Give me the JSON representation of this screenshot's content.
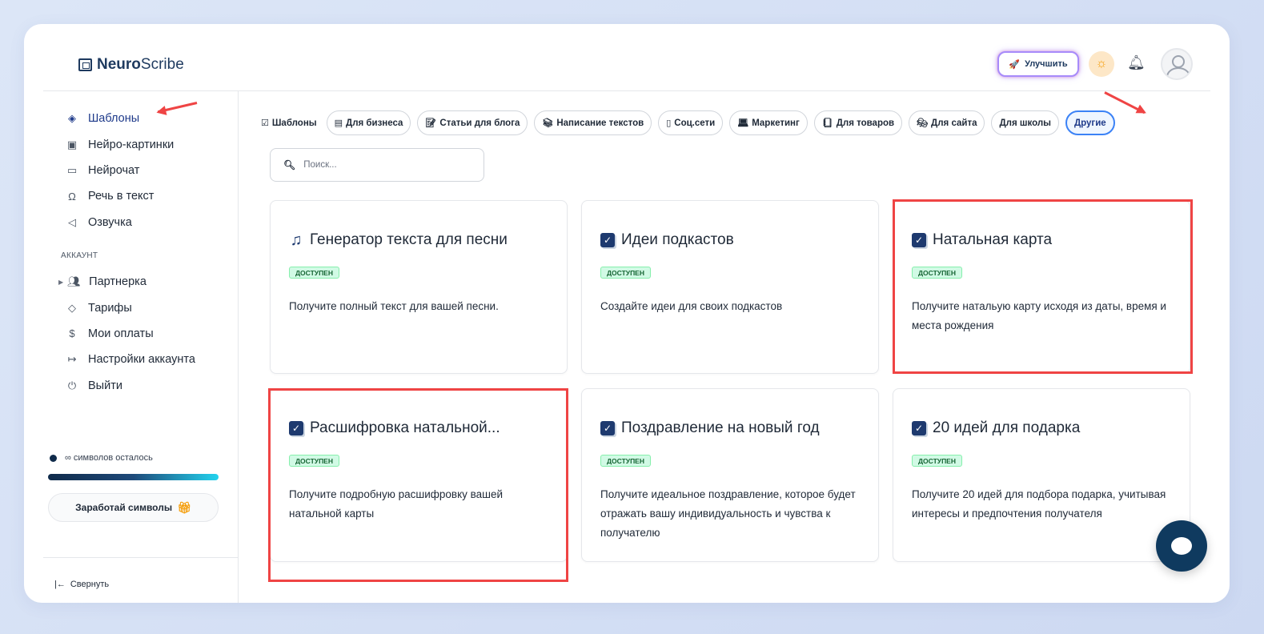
{
  "brand": {
    "bold": "Neuro",
    "light": "Scribe"
  },
  "header": {
    "upgrade_label": "Улучшить"
  },
  "sidebar": {
    "main_items": [
      {
        "label": "Шаблоны",
        "icon": "layers-icon"
      },
      {
        "label": "Нейро-картинки",
        "icon": "image-icon"
      },
      {
        "label": "Нейрочат",
        "icon": "chat-icon"
      },
      {
        "label": "Речь в текст",
        "icon": "headphones-icon"
      },
      {
        "label": "Озвучка",
        "icon": "speaker-icon"
      }
    ],
    "section_label": "АККАУНТ",
    "account_items": [
      {
        "label": "Партнерка",
        "icon": "users-icon"
      },
      {
        "label": "Тарифы",
        "icon": "tag-icon"
      },
      {
        "label": "Мои оплаты",
        "icon": "dollar-icon"
      },
      {
        "label": "Настройки аккаунта",
        "icon": "logout-arrow-icon"
      },
      {
        "label": "Выйти",
        "icon": "power-icon"
      }
    ],
    "symbols_left": "∞ символов осталось",
    "symbols_progress": 1.0,
    "earn_label": "Заработай символы",
    "collapse_label": "Свернуть"
  },
  "chips": [
    {
      "label": "Шаблоны",
      "icon": "checkbox-icon"
    },
    {
      "label": "Для бизнеса",
      "icon": "window-icon"
    },
    {
      "label": "Статьи для блога",
      "icon": "note-icon"
    },
    {
      "label": "Написание текстов",
      "icon": "books-icon"
    },
    {
      "label": "Соц.сети",
      "icon": "phone-icon"
    },
    {
      "label": "Маркетинг",
      "icon": "laptop-icon"
    },
    {
      "label": "Для товаров",
      "icon": "ledger-icon"
    },
    {
      "label": "Для сайта",
      "icon": "mask-icon"
    },
    {
      "label": "Для школы",
      "icon": ""
    },
    {
      "label": "Другие",
      "icon": "",
      "active": true
    }
  ],
  "search": {
    "placeholder": "Поиск..."
  },
  "cards": [
    {
      "title": "Генератор текста для песни",
      "badge": "ДОСТУПЕН",
      "desc": "Получите полный текст для вашей песни.",
      "icon": "music-note-icon"
    },
    {
      "title": "Идеи подкастов",
      "badge": "ДОСТУПЕН",
      "desc": "Создайте идеи для своих подкастов",
      "icon": "checkbox-icon"
    },
    {
      "title": "Натальная карта",
      "badge": "ДОСТУПЕН",
      "desc": "Получите натальую карту исходя из даты, время и места рождения",
      "icon": "checkbox-icon"
    },
    {
      "title": "Расшифровка натальной...",
      "badge": "ДОСТУПЕН",
      "desc": "Получите подробную расшифровку вашей натальной карты",
      "icon": "checkbox-icon"
    },
    {
      "title": "Поздравление на новый год",
      "badge": "ДОСТУПЕН",
      "desc": "Получите идеальное поздравление, которое будет отражать вашу индивидуальность и чувства к получателю",
      "icon": "checkbox-icon"
    },
    {
      "title": "20 идей для подарка",
      "badge": "ДОСТУПЕН",
      "desc": "Получите 20 идей для подбора подарка, учитывая интересы и предпочтения получателя",
      "icon": "checkbox-icon"
    }
  ],
  "colors": {
    "accent": "#1e3a8a",
    "highlight": "#ef4444",
    "badge_bg": "#d1fae5"
  }
}
